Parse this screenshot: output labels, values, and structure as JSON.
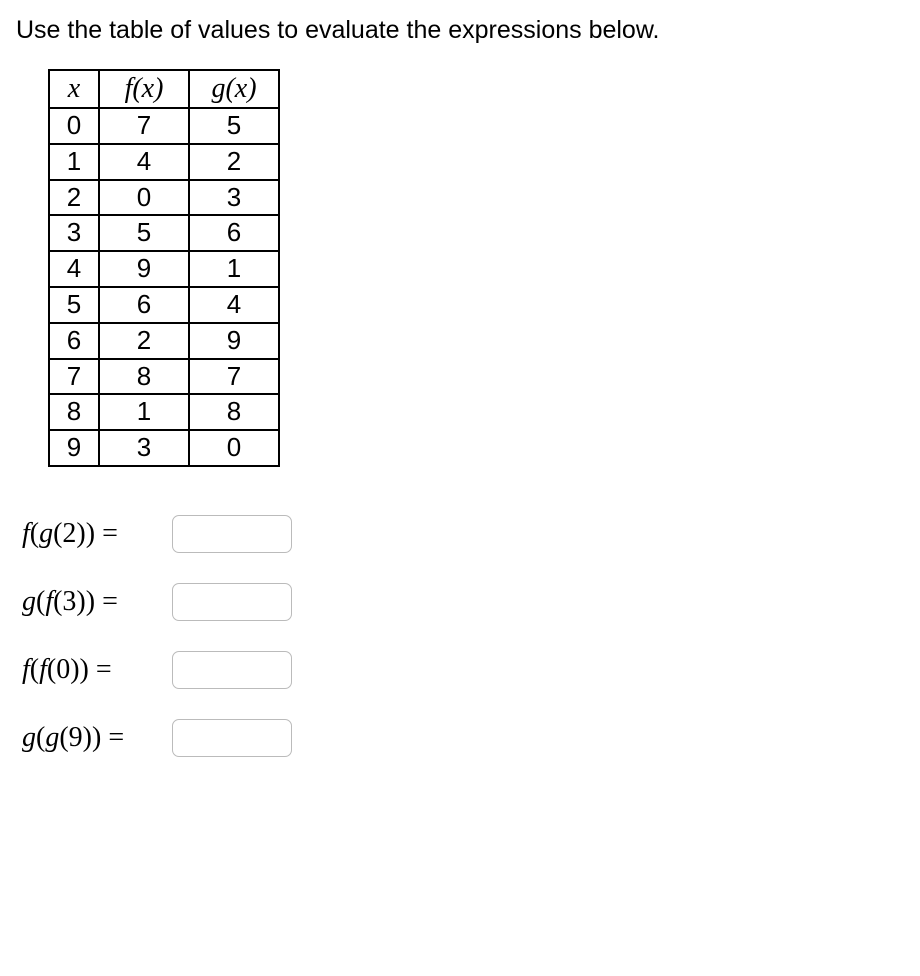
{
  "instruction": "Use the table of values to evaluate the expressions below.",
  "table": {
    "headers": {
      "x": "x",
      "f": "f(x)",
      "g": "g(x)"
    },
    "rows": [
      {
        "x": "0",
        "f": "7",
        "g": "5"
      },
      {
        "x": "1",
        "f": "4",
        "g": "2"
      },
      {
        "x": "2",
        "f": "0",
        "g": "3"
      },
      {
        "x": "3",
        "f": "5",
        "g": "6"
      },
      {
        "x": "4",
        "f": "9",
        "g": "1"
      },
      {
        "x": "5",
        "f": "6",
        "g": "4"
      },
      {
        "x": "6",
        "f": "2",
        "g": "9"
      },
      {
        "x": "7",
        "f": "8",
        "g": "7"
      },
      {
        "x": "8",
        "f": "1",
        "g": "8"
      },
      {
        "x": "9",
        "f": "3",
        "g": "0"
      }
    ]
  },
  "expressions": [
    {
      "outer": "f",
      "inner": "g",
      "arg": "2",
      "value": ""
    },
    {
      "outer": "g",
      "inner": "f",
      "arg": "3",
      "value": ""
    },
    {
      "outer": "f",
      "inner": "f",
      "arg": "0",
      "value": ""
    },
    {
      "outer": "g",
      "inner": "g",
      "arg": "9",
      "value": ""
    }
  ]
}
